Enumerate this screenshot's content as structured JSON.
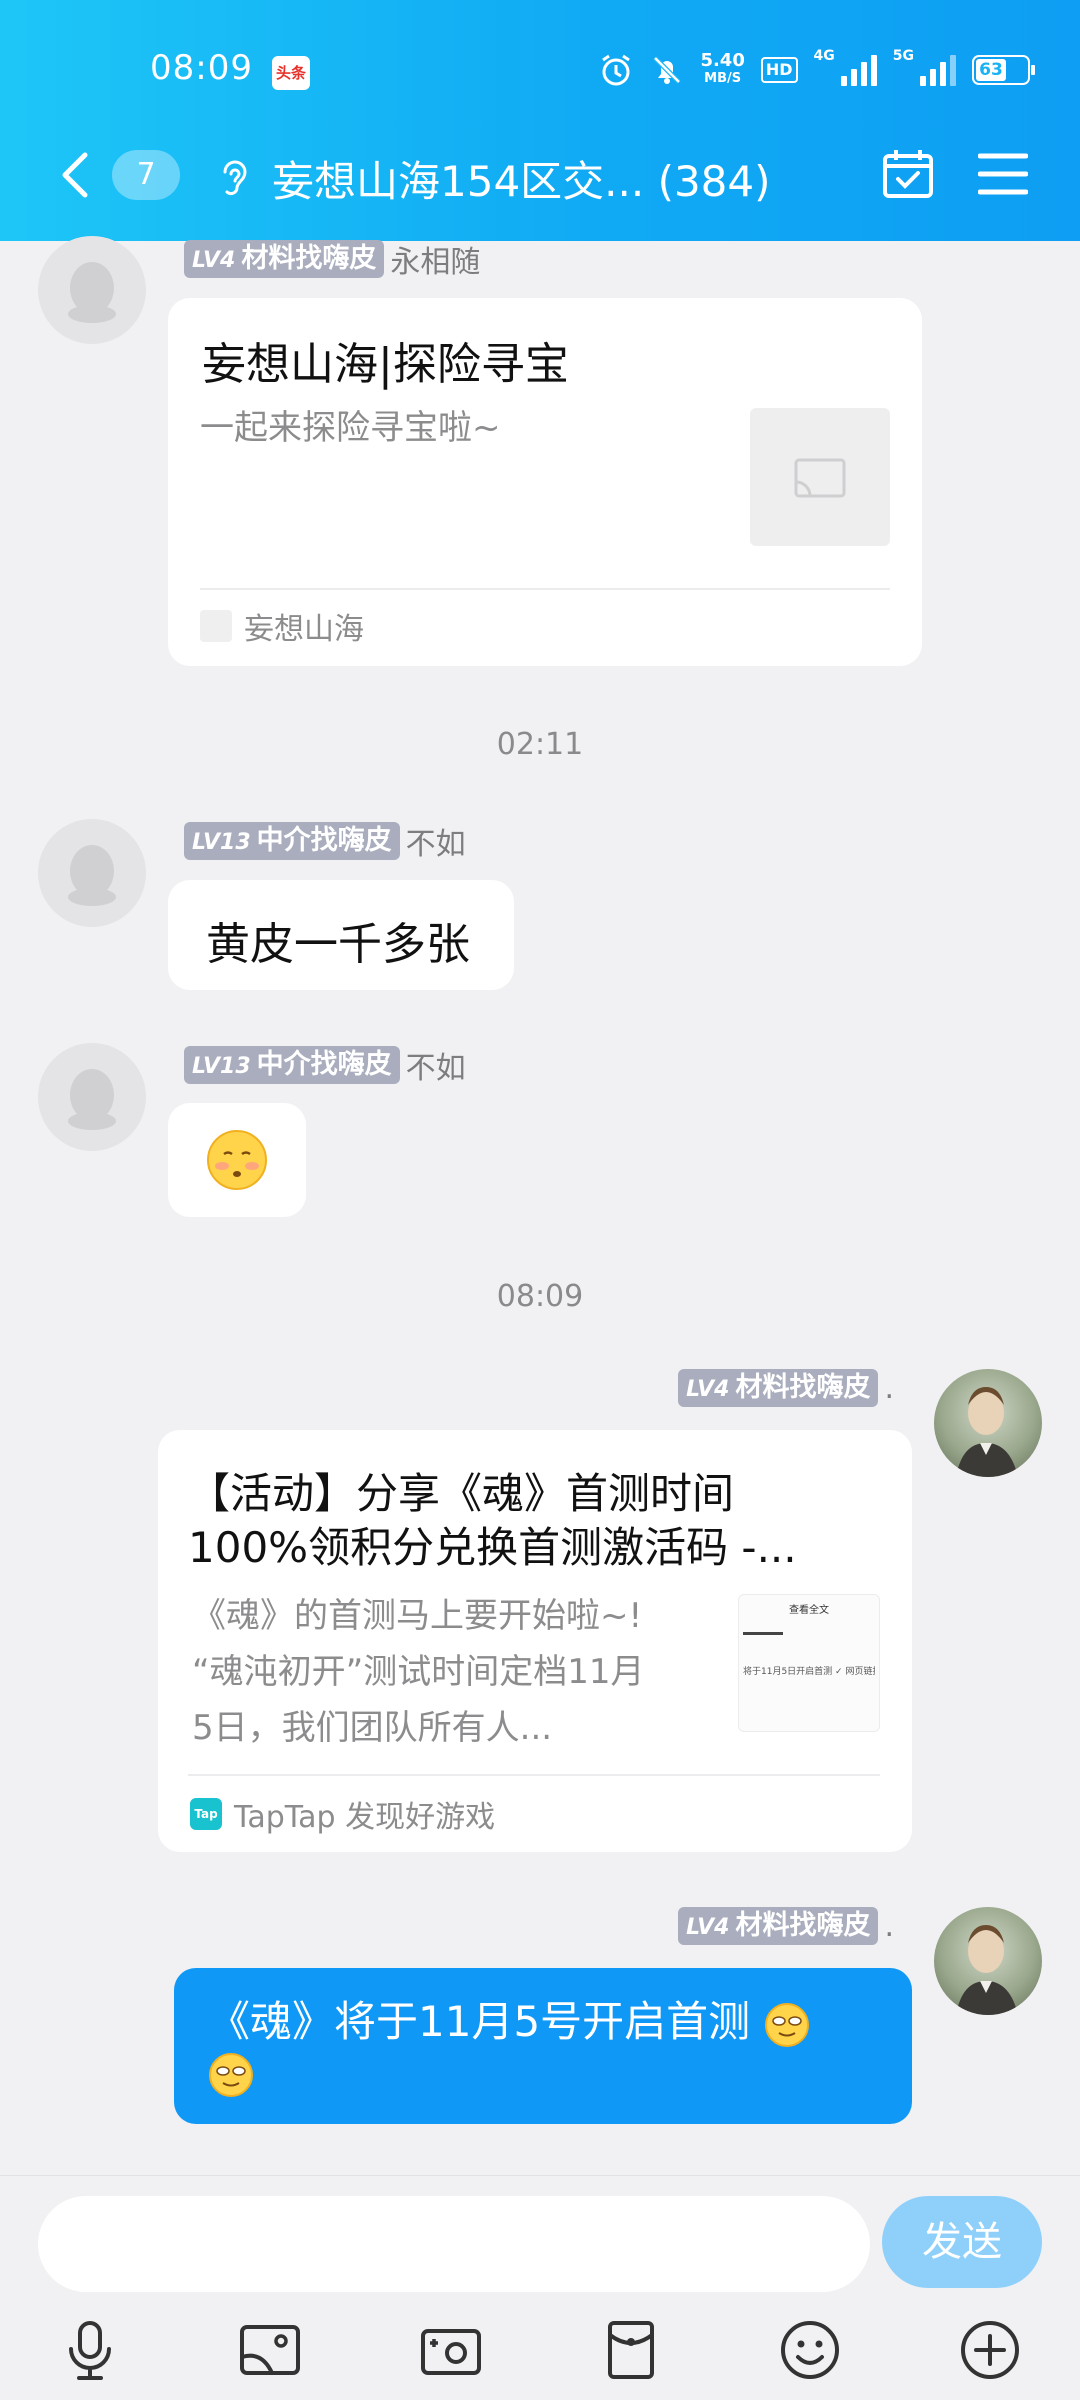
{
  "status_bar": {
    "time": "08:09",
    "app_badge": "头条",
    "net_speed": "5.40",
    "net_unit": "MB/S",
    "hd": "HD",
    "sig1_label": "4G",
    "sig2_label": "5G",
    "battery": "63"
  },
  "nav": {
    "unread": "7",
    "title": "妄想山海154区交... (384)"
  },
  "messages": {
    "m1": {
      "tag": "LV4",
      "tag_title": "材料找嗨皮",
      "sender": "永相随",
      "card_title": "妄想山海|探险寻宝",
      "card_desc": "一起来探险寻宝啦~",
      "card_source": "妄想山海"
    },
    "ts1": "02:11",
    "m2": {
      "tag": "LV13",
      "tag_title": "中介找嗨皮",
      "sender": "不如",
      "text": "黄皮一千多张"
    },
    "m3": {
      "tag": "LV13",
      "tag_title": "中介找嗨皮",
      "sender": "不如"
    },
    "ts2": "08:09",
    "m4": {
      "tag": "LV4",
      "tag_title": "材料找嗨皮",
      "sender": ".",
      "card_title_line1": "【活动】分享《魂》首测时间",
      "card_title_line2": "100%领积分兑换首测激活码 -...",
      "card_desc_line1": "《魂》的首测马上要开始啦~!",
      "card_desc_line2": "“魂沌初开”测试时间定档11月",
      "card_desc_line3": "5日，我们团队所有人...",
      "card_source": "TapTap 发现好游戏",
      "thumb_header": "查看全文",
      "thumb_text": "将于11月5日开启首测 ✓ 网页链接"
    },
    "m5": {
      "tag": "LV4",
      "tag_title": "材料找嗨皮",
      "sender": ".",
      "text": "《魂》将于11月5号开启首测"
    }
  },
  "input": {
    "send_label": "发送"
  },
  "colors": {
    "header_gradient_start": "#1ec6f7",
    "header_gradient_end": "#0e9ef3",
    "sent_bubble": "#0f98f6",
    "send_button": "#8fd0fb"
  },
  "icons": [
    "back-arrow-icon",
    "ear-icon",
    "calendar-check-icon",
    "menu-icon",
    "microphone-icon",
    "image-icon",
    "camera-icon",
    "red-packet-icon",
    "emoji-icon",
    "plus-icon"
  ]
}
